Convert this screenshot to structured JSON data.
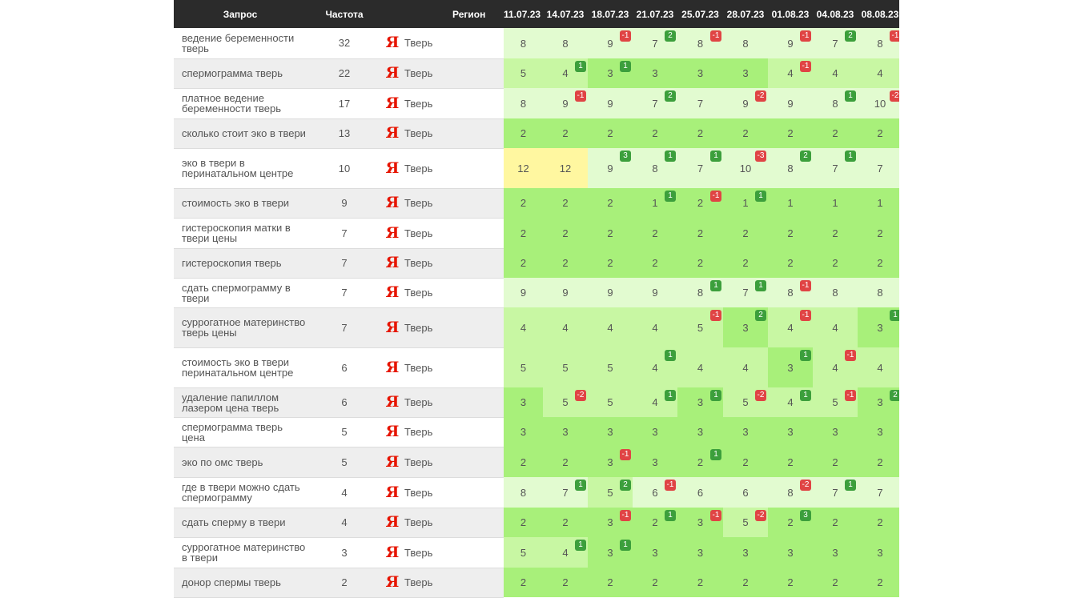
{
  "headers": {
    "query": "Запрос",
    "freq": "Частота",
    "region": "Регион",
    "dates": [
      "11.07.23",
      "14.07.23",
      "18.07.23",
      "21.07.23",
      "25.07.23",
      "28.07.23",
      "01.08.23",
      "04.08.23",
      "08.08.23"
    ]
  },
  "search_engine_glyph": "Я",
  "colors": {
    "top": "#a8f07a",
    "good": "#c8f7a3",
    "ok": "#e2fbd0",
    "warn": "#fff7a0",
    "badge_up": "#3c9f3c",
    "badge_down": "#e04444"
  },
  "rows": [
    {
      "query": "ведение беременности тверь",
      "freq": "32",
      "region": "Тверь",
      "positions": [
        "8",
        "8",
        "9",
        "7",
        "8",
        "8",
        "9",
        "7",
        "8"
      ],
      "deltas": [
        "",
        "",
        "-1",
        "2",
        "-1",
        "",
        "-1",
        "2",
        "-1"
      ]
    },
    {
      "query": "спермограмма тверь",
      "freq": "22",
      "region": "Тверь",
      "positions": [
        "5",
        "4",
        "3",
        "3",
        "3",
        "3",
        "4",
        "4",
        "4"
      ],
      "deltas": [
        "",
        "1",
        "1",
        "",
        "",
        "",
        "-1",
        "",
        ""
      ]
    },
    {
      "query": "платное ведение беременности тверь",
      "freq": "17",
      "region": "Тверь",
      "positions": [
        "8",
        "9",
        "9",
        "7",
        "7",
        "9",
        "9",
        "8",
        "10"
      ],
      "deltas": [
        "",
        "-1",
        "",
        "2",
        "",
        "-2",
        "",
        "1",
        "-2"
      ]
    },
    {
      "query": "сколько стоит эко в твери",
      "freq": "13",
      "region": "Тверь",
      "positions": [
        "2",
        "2",
        "2",
        "2",
        "2",
        "2",
        "2",
        "2",
        "2"
      ],
      "deltas": [
        "",
        "",
        "",
        "",
        "",
        "",
        "",
        "",
        ""
      ]
    },
    {
      "query": "эко в твери в перинатальном центре",
      "freq": "10",
      "region": "Тверь",
      "positions": [
        "12",
        "12",
        "9",
        "8",
        "7",
        "10",
        "8",
        "7",
        "7"
      ],
      "deltas": [
        "",
        "",
        "3",
        "1",
        "1",
        "-3",
        "2",
        "1",
        ""
      ]
    },
    {
      "query": "стоимость эко в твери",
      "freq": "9",
      "region": "Тверь",
      "positions": [
        "2",
        "2",
        "2",
        "1",
        "2",
        "1",
        "1",
        "1",
        "1"
      ],
      "deltas": [
        "",
        "",
        "",
        "1",
        "-1",
        "1",
        "",
        "",
        ""
      ]
    },
    {
      "query": "гистероскопия матки в твери цены",
      "freq": "7",
      "region": "Тверь",
      "positions": [
        "2",
        "2",
        "2",
        "2",
        "2",
        "2",
        "2",
        "2",
        "2"
      ],
      "deltas": [
        "",
        "",
        "",
        "",
        "",
        "",
        "",
        "",
        ""
      ]
    },
    {
      "query": "гистероскопия тверь",
      "freq": "7",
      "region": "Тверь",
      "positions": [
        "2",
        "2",
        "2",
        "2",
        "2",
        "2",
        "2",
        "2",
        "2"
      ],
      "deltas": [
        "",
        "",
        "",
        "",
        "",
        "",
        "",
        "",
        ""
      ]
    },
    {
      "query": "сдать спермограмму в твери",
      "freq": "7",
      "region": "Тверь",
      "positions": [
        "9",
        "9",
        "9",
        "9",
        "8",
        "7",
        "8",
        "8",
        "8"
      ],
      "deltas": [
        "",
        "",
        "",
        "",
        "1",
        "1",
        "-1",
        "",
        ""
      ]
    },
    {
      "query": "суррогатное материнство тверь цены",
      "freq": "7",
      "region": "Тверь",
      "positions": [
        "4",
        "4",
        "4",
        "4",
        "5",
        "3",
        "4",
        "4",
        "3"
      ],
      "deltas": [
        "",
        "",
        "",
        "",
        "-1",
        "2",
        "-1",
        "",
        "1"
      ]
    },
    {
      "query": "стоимость эко в твери перинатальном центре",
      "freq": "6",
      "region": "Тверь",
      "positions": [
        "5",
        "5",
        "5",
        "4",
        "4",
        "4",
        "3",
        "4",
        "4"
      ],
      "deltas": [
        "",
        "",
        "",
        "1",
        "",
        "",
        "1",
        "-1",
        ""
      ]
    },
    {
      "query": "удаление папиллом лазером цена тверь",
      "freq": "6",
      "region": "Тверь",
      "positions": [
        "3",
        "5",
        "5",
        "4",
        "3",
        "5",
        "4",
        "5",
        "3"
      ],
      "deltas": [
        "",
        "-2",
        "",
        "1",
        "1",
        "-2",
        "1",
        "-1",
        "2"
      ]
    },
    {
      "query": "спермограмма тверь цена",
      "freq": "5",
      "region": "Тверь",
      "positions": [
        "3",
        "3",
        "3",
        "3",
        "3",
        "3",
        "3",
        "3",
        "3"
      ],
      "deltas": [
        "",
        "",
        "",
        "",
        "",
        "",
        "",
        "",
        ""
      ]
    },
    {
      "query": "эко по омс тверь",
      "freq": "5",
      "region": "Тверь",
      "positions": [
        "2",
        "2",
        "3",
        "3",
        "2",
        "2",
        "2",
        "2",
        "2"
      ],
      "deltas": [
        "",
        "",
        "-1",
        "",
        "1",
        "",
        "",
        "",
        ""
      ]
    },
    {
      "query": "где в твери можно сдать спермограмму",
      "freq": "4",
      "region": "Тверь",
      "positions": [
        "8",
        "7",
        "5",
        "6",
        "6",
        "6",
        "8",
        "7",
        "7"
      ],
      "deltas": [
        "",
        "1",
        "2",
        "-1",
        "",
        "",
        "-2",
        "1",
        ""
      ]
    },
    {
      "query": "сдать сперму в твери",
      "freq": "4",
      "region": "Тверь",
      "positions": [
        "2",
        "2",
        "3",
        "2",
        "3",
        "5",
        "2",
        "2",
        "2"
      ],
      "deltas": [
        "",
        "",
        "-1",
        "1",
        "-1",
        "-2",
        "3",
        "",
        ""
      ]
    },
    {
      "query": "суррогатное материнство в твери",
      "freq": "3",
      "region": "Тверь",
      "positions": [
        "5",
        "4",
        "3",
        "3",
        "3",
        "3",
        "3",
        "3",
        "3"
      ],
      "deltas": [
        "",
        "1",
        "1",
        "",
        "",
        "",
        "",
        "",
        ""
      ]
    },
    {
      "query": "донор спермы тверь",
      "freq": "2",
      "region": "Тверь",
      "positions": [
        "2",
        "2",
        "2",
        "2",
        "2",
        "2",
        "2",
        "2",
        "2"
      ],
      "deltas": [
        "",
        "",
        "",
        "",
        "",
        "",
        "",
        "",
        ""
      ]
    }
  ]
}
